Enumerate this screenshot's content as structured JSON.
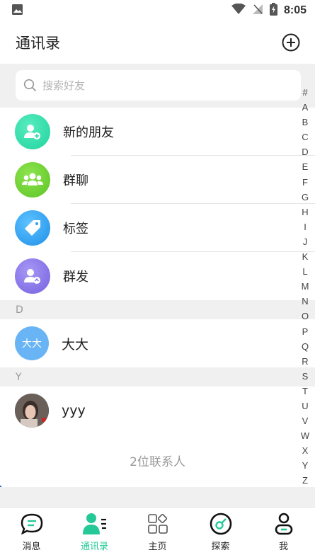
{
  "status_bar": {
    "time": "8:05"
  },
  "header": {
    "title": "通讯录"
  },
  "search": {
    "placeholder": "搜索好友"
  },
  "entries": [
    {
      "label": "新的朋友",
      "icon": "add-user-icon",
      "color": "#2fd9a9"
    },
    {
      "label": "群聊",
      "icon": "group-icon",
      "color": "#6fd134"
    },
    {
      "label": "标签",
      "icon": "tag-icon",
      "color": "#2d9ff0"
    },
    {
      "label": "群发",
      "icon": "broadcast-icon",
      "color": "#8a78e8"
    }
  ],
  "sections": [
    {
      "letter": "D",
      "contacts": [
        {
          "name": "大大",
          "avatar_text": "大大",
          "avatar_color": "#69b4f5"
        }
      ]
    },
    {
      "letter": "Y",
      "contacts": [
        {
          "name": "yyy",
          "avatar_text": "",
          "avatar_color": "#777777"
        }
      ]
    }
  ],
  "footer": {
    "count_text": "2位联系人"
  },
  "index_letters": [
    "#",
    "A",
    "B",
    "C",
    "D",
    "E",
    "F",
    "G",
    "H",
    "I",
    "J",
    "K",
    "L",
    "M",
    "N",
    "O",
    "P",
    "Q",
    "R",
    "S",
    "T",
    "U",
    "V",
    "W",
    "X",
    "Y",
    "Z"
  ],
  "nav": [
    {
      "label": "消息",
      "icon": "chat-bubble-icon",
      "active": false
    },
    {
      "label": "通讯录",
      "icon": "contacts-icon",
      "active": true
    },
    {
      "label": "主页",
      "icon": "grid-icon",
      "active": false
    },
    {
      "label": "探索",
      "icon": "explore-icon",
      "active": false
    },
    {
      "label": "我",
      "icon": "profile-icon",
      "active": false
    }
  ],
  "colors": {
    "accent": "#25c997",
    "background": "#f0f0f0"
  }
}
